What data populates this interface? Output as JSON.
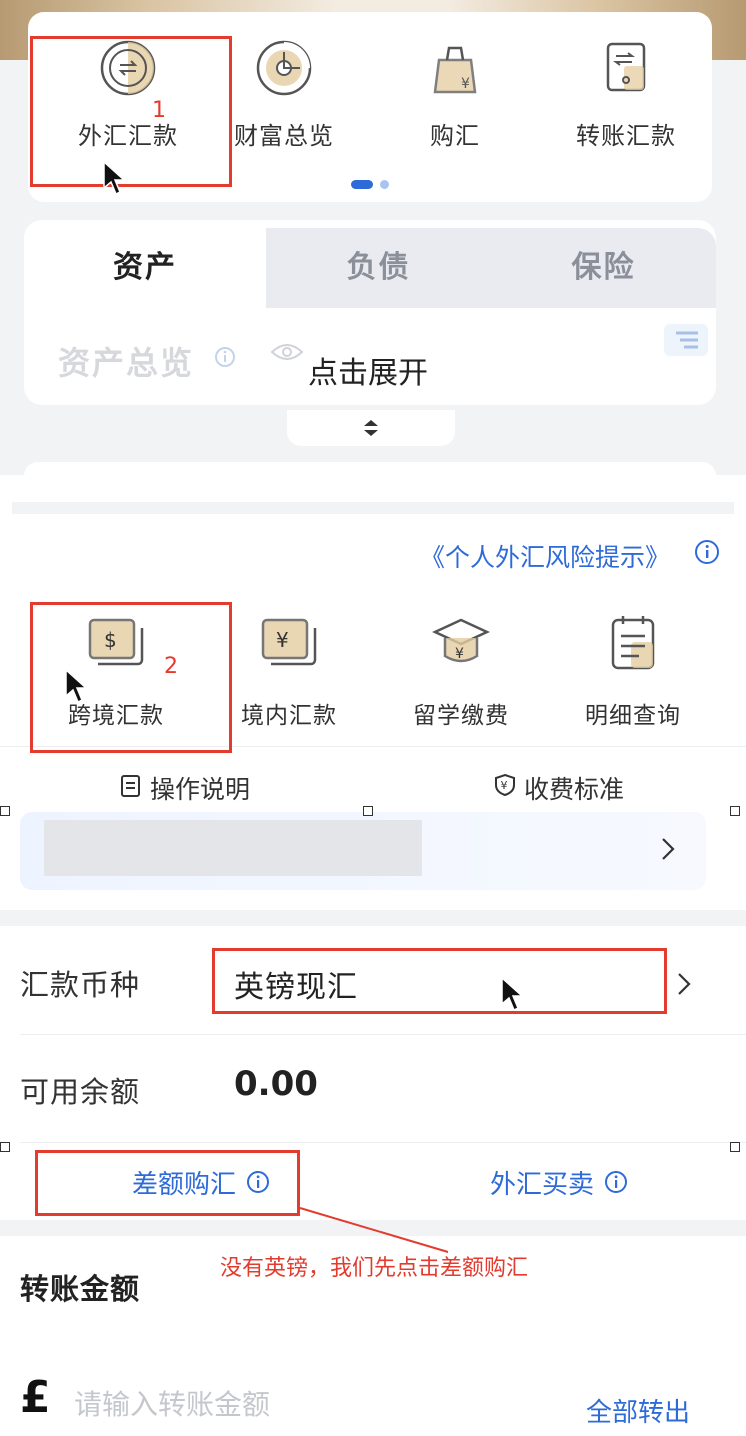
{
  "quick_menu": {
    "items": [
      {
        "label": "外汇汇款",
        "icon": "fx-remittance-icon"
      },
      {
        "label": "财富总览",
        "icon": "wealth-overview-icon"
      },
      {
        "label": "购汇",
        "icon": "buy-fx-icon"
      },
      {
        "label": "转账汇款",
        "icon": "transfer-icon"
      }
    ],
    "page_indicator": {
      "pages": 2,
      "active": 1
    }
  },
  "asset_tabs": {
    "tabs": [
      "资产",
      "负债",
      "保险"
    ],
    "active": "资产",
    "title": "资产总览",
    "expand_label": "点击展开"
  },
  "remittance": {
    "risk_link": "《个人外汇风险提示》",
    "services": [
      {
        "label": "跨境汇款",
        "icon": "dollar-card-icon"
      },
      {
        "label": "境内汇款",
        "icon": "yuan-card-icon"
      },
      {
        "label": "留学缴费",
        "icon": "graduation-cap-icon"
      },
      {
        "label": "明细查询",
        "icon": "clipboard-icon"
      }
    ],
    "ops_note": "操作说明",
    "fee_standard": "收费标准"
  },
  "form": {
    "currency_label": "汇款币种",
    "currency_value": "英镑现汇",
    "balance_label": "可用余额",
    "balance_value": "0.00",
    "diff_buy": "差额购汇",
    "fx_trade": "外汇买卖",
    "amount_label": "转账金额",
    "currency_symbol": "£",
    "amount_placeholder": "请输入转账金额",
    "transfer_all": "全部转出"
  },
  "annotations": {
    "mark_1": "1",
    "mark_2": "2",
    "note": "没有英镑，我们先点击差额购汇"
  },
  "colors": {
    "accent_blue": "#2e6bd8",
    "annotation_red": "#e33b2e",
    "gold": "#c9a063"
  }
}
